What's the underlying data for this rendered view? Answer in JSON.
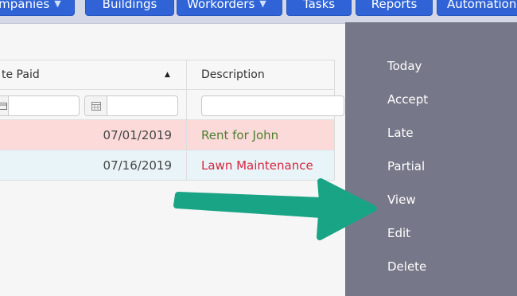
{
  "nav": {
    "items": [
      {
        "label": "ompanies",
        "has_caret": true
      },
      {
        "label": "Buildings",
        "has_caret": false
      },
      {
        "label": "Workorders",
        "has_caret": true
      },
      {
        "label": "Tasks",
        "has_caret": false
      },
      {
        "label": "Reports",
        "has_caret": false
      },
      {
        "label": "Automation",
        "has_caret": false
      }
    ],
    "caret_glyph": "⌵"
  },
  "table": {
    "columns": [
      "te Paid",
      "Description"
    ],
    "sort_indicator": "▲",
    "filter_icon": "calendar-icon",
    "rows": [
      {
        "date": "07/01/2019",
        "description": "Rent for John",
        "status": "late"
      },
      {
        "date": "07/16/2019",
        "description": "Lawn Maintenance",
        "status": "normal"
      }
    ]
  },
  "menu": {
    "items": [
      "Today",
      "Accept",
      "Late",
      "Partial",
      "View",
      "Edit",
      "Delete"
    ]
  },
  "colors": {
    "nav_button": "#2f63d6",
    "menu_bg": "#767889",
    "arrow": "#1aa486",
    "late_row": "#fcdada",
    "normal_row": "#e9f4f8"
  }
}
